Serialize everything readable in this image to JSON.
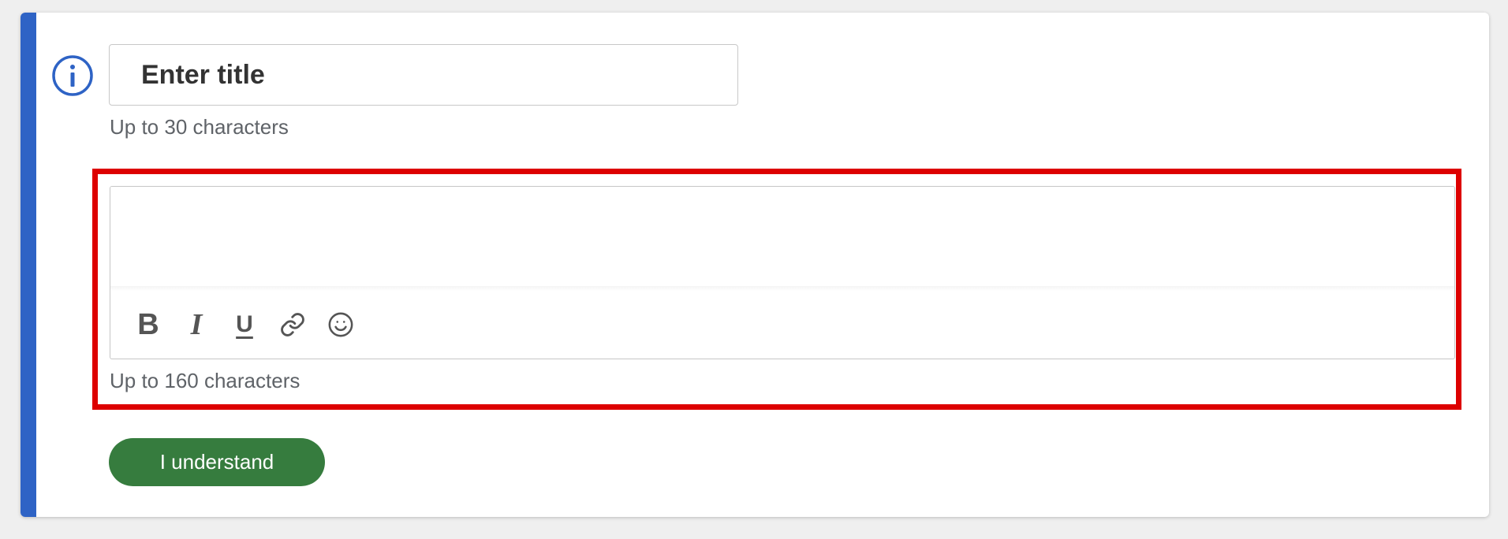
{
  "colors": {
    "accent_bar": "#2e63c5",
    "info_icon": "#2e63c5",
    "highlight_border": "#dd0000",
    "button_bg": "#367c3e",
    "button_text": "#ffffff"
  },
  "title_field": {
    "placeholder": "Enter title",
    "value": "",
    "hint": "Up to 30 characters"
  },
  "body_field": {
    "value": "",
    "hint": "Up to 160 characters",
    "toolbar": {
      "bold": "B",
      "italic": "I",
      "underline": "U",
      "link_icon": "link-icon",
      "emoji_icon": "smiley-icon"
    }
  },
  "confirm_button": {
    "label": "I understand"
  }
}
